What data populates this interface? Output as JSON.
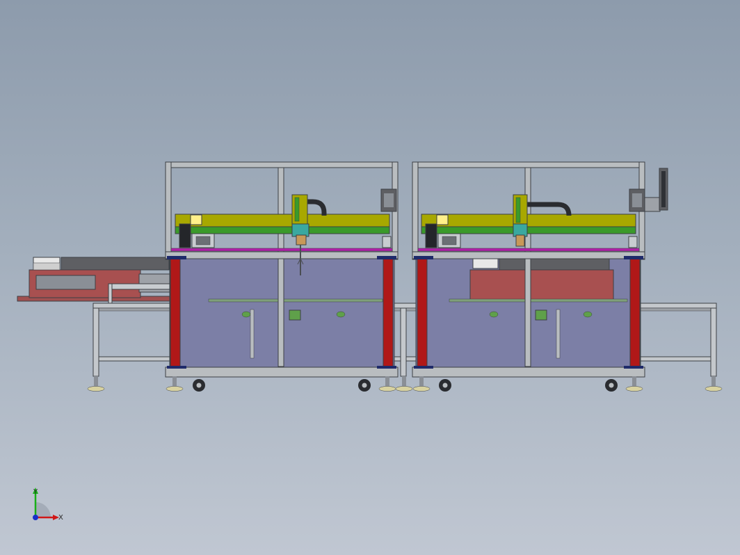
{
  "viewport": {
    "background_top": "#8d9bac",
    "background_bottom": "#c0c7d2"
  },
  "triad": {
    "x_label": "X",
    "y_label": "Y",
    "x_color": "#d01818",
    "y_color": "#18b018",
    "z_color": "#1830c8"
  },
  "colors": {
    "frame": "#b9bdc0",
    "frame_edge": "#3c3f44",
    "enclosure": "#7c7fa6",
    "red_post": "#b01818",
    "gantry_yellow": "#a8a800",
    "gantry_green": "#3a9a2a",
    "magenta_rail": "#b020a8",
    "feeder_red": "#a85050"
  }
}
